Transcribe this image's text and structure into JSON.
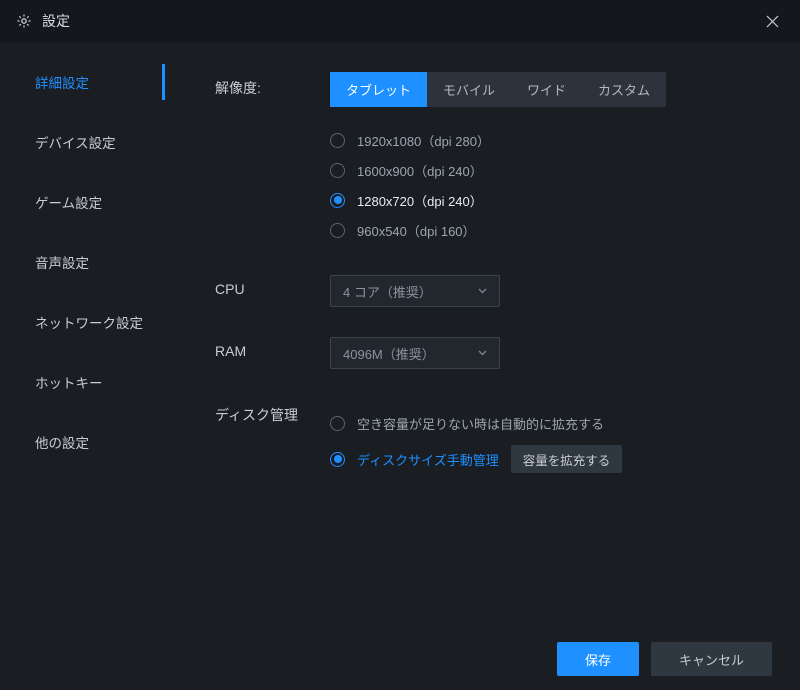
{
  "window": {
    "title": "設定"
  },
  "sidebar": {
    "items": [
      {
        "label": "詳細設定",
        "active": true
      },
      {
        "label": "デバイス設定",
        "active": false
      },
      {
        "label": "ゲーム設定",
        "active": false
      },
      {
        "label": "音声設定",
        "active": false
      },
      {
        "label": "ネットワーク設定",
        "active": false
      },
      {
        "label": "ホットキー",
        "active": false
      },
      {
        "label": "他の設定",
        "active": false
      }
    ]
  },
  "resolution": {
    "label": "解像度:",
    "tabs": [
      {
        "label": "タブレット",
        "active": true
      },
      {
        "label": "モバイル",
        "active": false
      },
      {
        "label": "ワイド",
        "active": false
      },
      {
        "label": "カスタム",
        "active": false
      }
    ],
    "options": [
      {
        "label": "1920x1080（dpi 280）",
        "selected": false
      },
      {
        "label": "1600x900（dpi 240）",
        "selected": false
      },
      {
        "label": "1280x720（dpi 240）",
        "selected": true
      },
      {
        "label": "960x540（dpi 160）",
        "selected": false
      }
    ]
  },
  "cpu": {
    "label": "CPU",
    "value": "4 コア（推奨）"
  },
  "ram": {
    "label": "RAM",
    "value": "4096M（推奨）"
  },
  "disk": {
    "label": "ディスク管理",
    "options": [
      {
        "label": "空き容量が足りない時は自動的に拡充する",
        "selected": false
      },
      {
        "label": "ディスクサイズ手動管理",
        "selected": true
      }
    ],
    "expand_button": "容量を拡充する"
  },
  "footer": {
    "save": "保存",
    "cancel": "キャンセル"
  }
}
